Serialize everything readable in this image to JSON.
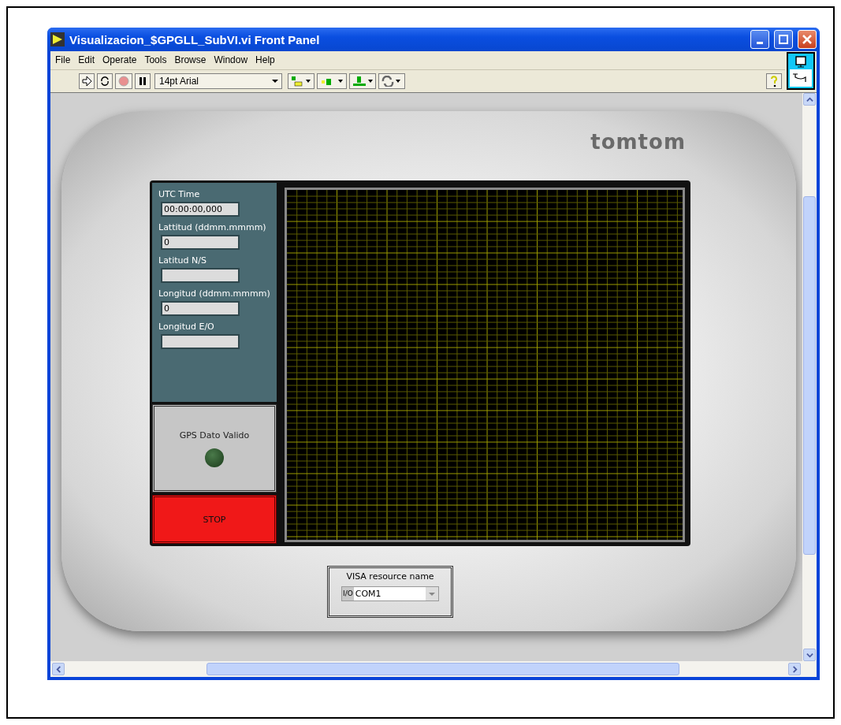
{
  "window": {
    "title": "Visualizacion_$GPGLL_SubVI.vi Front Panel"
  },
  "menu": [
    "File",
    "Edit",
    "Operate",
    "Tools",
    "Browse",
    "Window",
    "Help"
  ],
  "toolbar": {
    "font": "14pt Arial",
    "running": false
  },
  "panel": {
    "brand": "tomtom",
    "fields": [
      {
        "label": "UTC Time",
        "value": "00:00:00,000"
      },
      {
        "label": "Lattitud (ddmm.mmmm)",
        "value": "0"
      },
      {
        "label": "Latitud N/S"
      },
      {
        "label": "Longitud (ddmm.mmmm)",
        "value": "0"
      },
      {
        "label": "Longitud E/O"
      }
    ],
    "led": {
      "label": "GPS Dato Valido",
      "on": false
    },
    "stop_button": "STOP",
    "visa": {
      "label": "VISA resource name",
      "prefix": "I/O",
      "value": "COM1"
    }
  }
}
